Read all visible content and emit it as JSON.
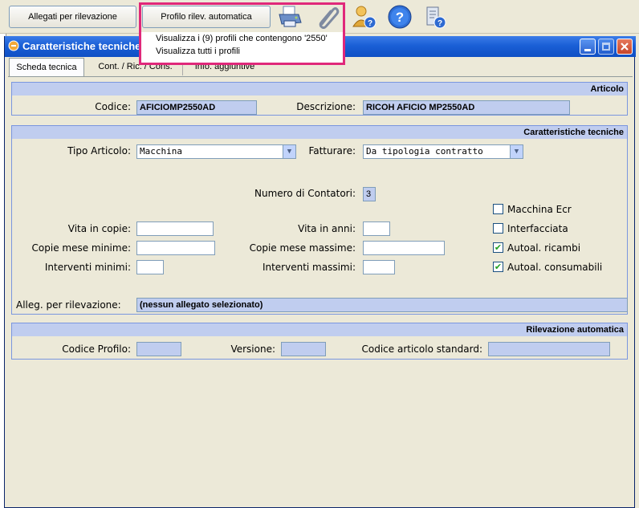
{
  "toolbar": {
    "allegati_label": "Allegati per rilevazione",
    "profilo_label": "Profilo rilev. automatica"
  },
  "popup": {
    "item1": "Visualizza i (9) profili che contengono '2550'",
    "item2": "Visualizza tutti i profili"
  },
  "window": {
    "title": "Caratteristiche tecniche"
  },
  "tabs": {
    "scheda": "Scheda tecnica",
    "cont": "Cont. / Ric. / Cons.",
    "info": "Info. aggiuntive"
  },
  "articolo": {
    "header": "Articolo",
    "codice_label": "Codice:",
    "codice_value": "AFICIOMP2550AD",
    "descr_label": "Descrizione:",
    "descr_value": "RICOH AFICIO MP2550AD"
  },
  "caratt": {
    "header": "Caratteristiche tecniche",
    "tipo_label": "Tipo Articolo:",
    "tipo_value": "Macchina",
    "fatt_label": "Fatturare:",
    "fatt_value": "Da tipologia contratto",
    "contatori_label": "Numero di Contatori:",
    "contatori_value": "3",
    "vita_copie_label": "Vita in copie:",
    "vita_anni_label": "Vita in anni:",
    "copie_min_label": "Copie mese minime:",
    "copie_max_label": "Copie mese massime:",
    "int_min_label": "Interventi minimi:",
    "int_max_label": "Interventi massimi:",
    "macchina_ecr": "Macchina Ecr",
    "interfacciata": "Interfacciata",
    "autoal_ricambi": "Autoal. ricambi",
    "autoal_consumabili": "Autoal. consumabili",
    "alleg_label": "Alleg. per rilevazione:",
    "alleg_value": "(nessun allegato selezionato)"
  },
  "rilevazione": {
    "header": "Rilevazione automatica",
    "codice_profilo_label": "Codice Profilo:",
    "versione_label": "Versione:",
    "codice_std_label": "Codice articolo standard:"
  }
}
